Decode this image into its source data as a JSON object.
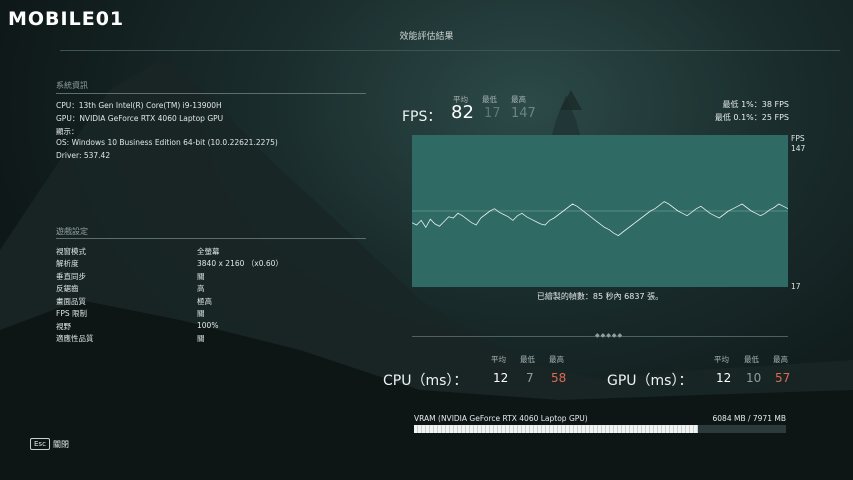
{
  "logo": {
    "text": "MOBILE01"
  },
  "page_title": "效能評估結果",
  "system_info": {
    "title": "系統資訊",
    "lines": [
      "CPU：13th Gen Intel(R) Core(TM) i9-13900H",
      "GPU：NVIDIA GeForce RTX 4060 Laptop GPU",
      "顯示：",
      "OS: Windows 10 Business Edition 64-bit (10.0.22621.2275)",
      "Driver: 537.42"
    ]
  },
  "game_settings": {
    "title": "遊戲設定",
    "rows": [
      {
        "label": "視窗模式",
        "value": "全螢幕"
      },
      {
        "label": "解析度",
        "value": "3840 x 2160 （x0.60）"
      },
      {
        "label": "垂直同步",
        "value": "關"
      },
      {
        "label": "反鋸齒",
        "value": "高"
      },
      {
        "label": "畫面品質",
        "value": "極高"
      },
      {
        "label": "FPS 限制",
        "value": "關"
      },
      {
        "label": "視野",
        "value": "100%"
      },
      {
        "label": "適應性品質",
        "value": "關"
      }
    ]
  },
  "fps": {
    "label": "FPS：",
    "avg_head": "平均",
    "min_head": "最低",
    "max_head": "最高",
    "avg": "82",
    "min": "17",
    "max": "147",
    "low1_label": "最低 1%：",
    "low1_value": "38 FPS",
    "low01_label": "最低 0.1%：",
    "low01_value": "25 FPS"
  },
  "chart_data": {
    "type": "line",
    "y_unit": "FPS",
    "ylim": [
      17,
      147
    ],
    "y_tick_labels": [
      "147",
      "17"
    ],
    "frames_note": "已繪製的幀數：85 秒內 6837 張。",
    "colors": {
      "background": "#2f6a64",
      "line": "#e8f0ef",
      "grid": "#6a9892"
    },
    "series": [
      {
        "values": [
          72,
          70,
          74,
          68,
          75,
          71,
          69,
          73,
          77,
          76,
          80,
          78,
          75,
          72,
          70,
          76,
          79,
          82,
          84,
          81,
          79,
          77,
          74,
          78,
          80,
          77,
          75,
          73,
          71,
          70,
          74,
          76,
          79,
          82,
          85,
          88,
          86,
          83,
          80,
          77,
          74,
          71,
          68,
          66,
          63,
          61,
          64,
          67,
          70,
          73,
          76,
          79,
          82,
          84,
          87,
          90,
          88,
          85,
          82,
          80,
          78,
          81,
          84,
          86,
          83,
          80,
          78,
          76,
          79,
          82,
          84,
          86,
          88,
          85,
          82,
          80,
          78,
          80,
          83,
          85,
          88,
          86,
          84
        ]
      }
    ]
  },
  "cpu": {
    "label": "CPU（ms）：",
    "avg_head": "平均",
    "min_head": "最低",
    "max_head": "最高",
    "avg": "12",
    "min": "7",
    "max": "58"
  },
  "gpu": {
    "label": "GPU（ms）：",
    "avg_head": "平均",
    "min_head": "最低",
    "max_head": "最高",
    "avg": "12",
    "min": "10",
    "max": "57"
  },
  "vram": {
    "label": "VRAM (NVIDIA GeForce RTX 4060 Laptop GPU)",
    "value": "6084 MB / 7971 MB",
    "used_fraction": 0.763
  },
  "footer": {
    "esc_key": "Esc",
    "close_label": "關閉"
  }
}
